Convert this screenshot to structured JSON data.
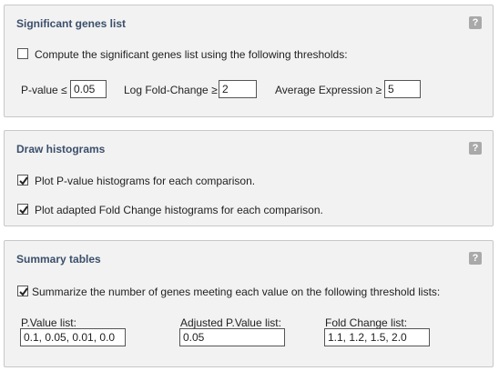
{
  "help_label": "?",
  "significant": {
    "title": "Significant genes list",
    "checkbox_checked": false,
    "checkbox_label": "Compute the significant genes list using the following thresholds:",
    "pvalue_label": "P-value ≤",
    "pvalue_value": "0.05",
    "logfc_label": "Log Fold-Change ≥",
    "logfc_value": "2",
    "avgexpr_label": "Average Expression ≥",
    "avgexpr_value": "5"
  },
  "histograms": {
    "title": "Draw histograms",
    "items": [
      {
        "checked": true,
        "label": "Plot P-value histograms for each comparison."
      },
      {
        "checked": true,
        "label": "Plot adapted Fold Change histograms for each comparison."
      }
    ]
  },
  "summary": {
    "title": "Summary tables",
    "checkbox_checked": true,
    "checkbox_label": "Summarize the number of genes meeting each value on the following threshold lists:",
    "pvalue_list_label": "P.Value list:",
    "pvalue_list_value": "0.1, 0.05, 0.01, 0.0",
    "adj_pvalue_list_label": "Adjusted P.Value list:",
    "adj_pvalue_list_value": "0.05",
    "fc_list_label": "Fold Change list:",
    "fc_list_value": "1.1, 1.2, 1.5, 2.0"
  }
}
